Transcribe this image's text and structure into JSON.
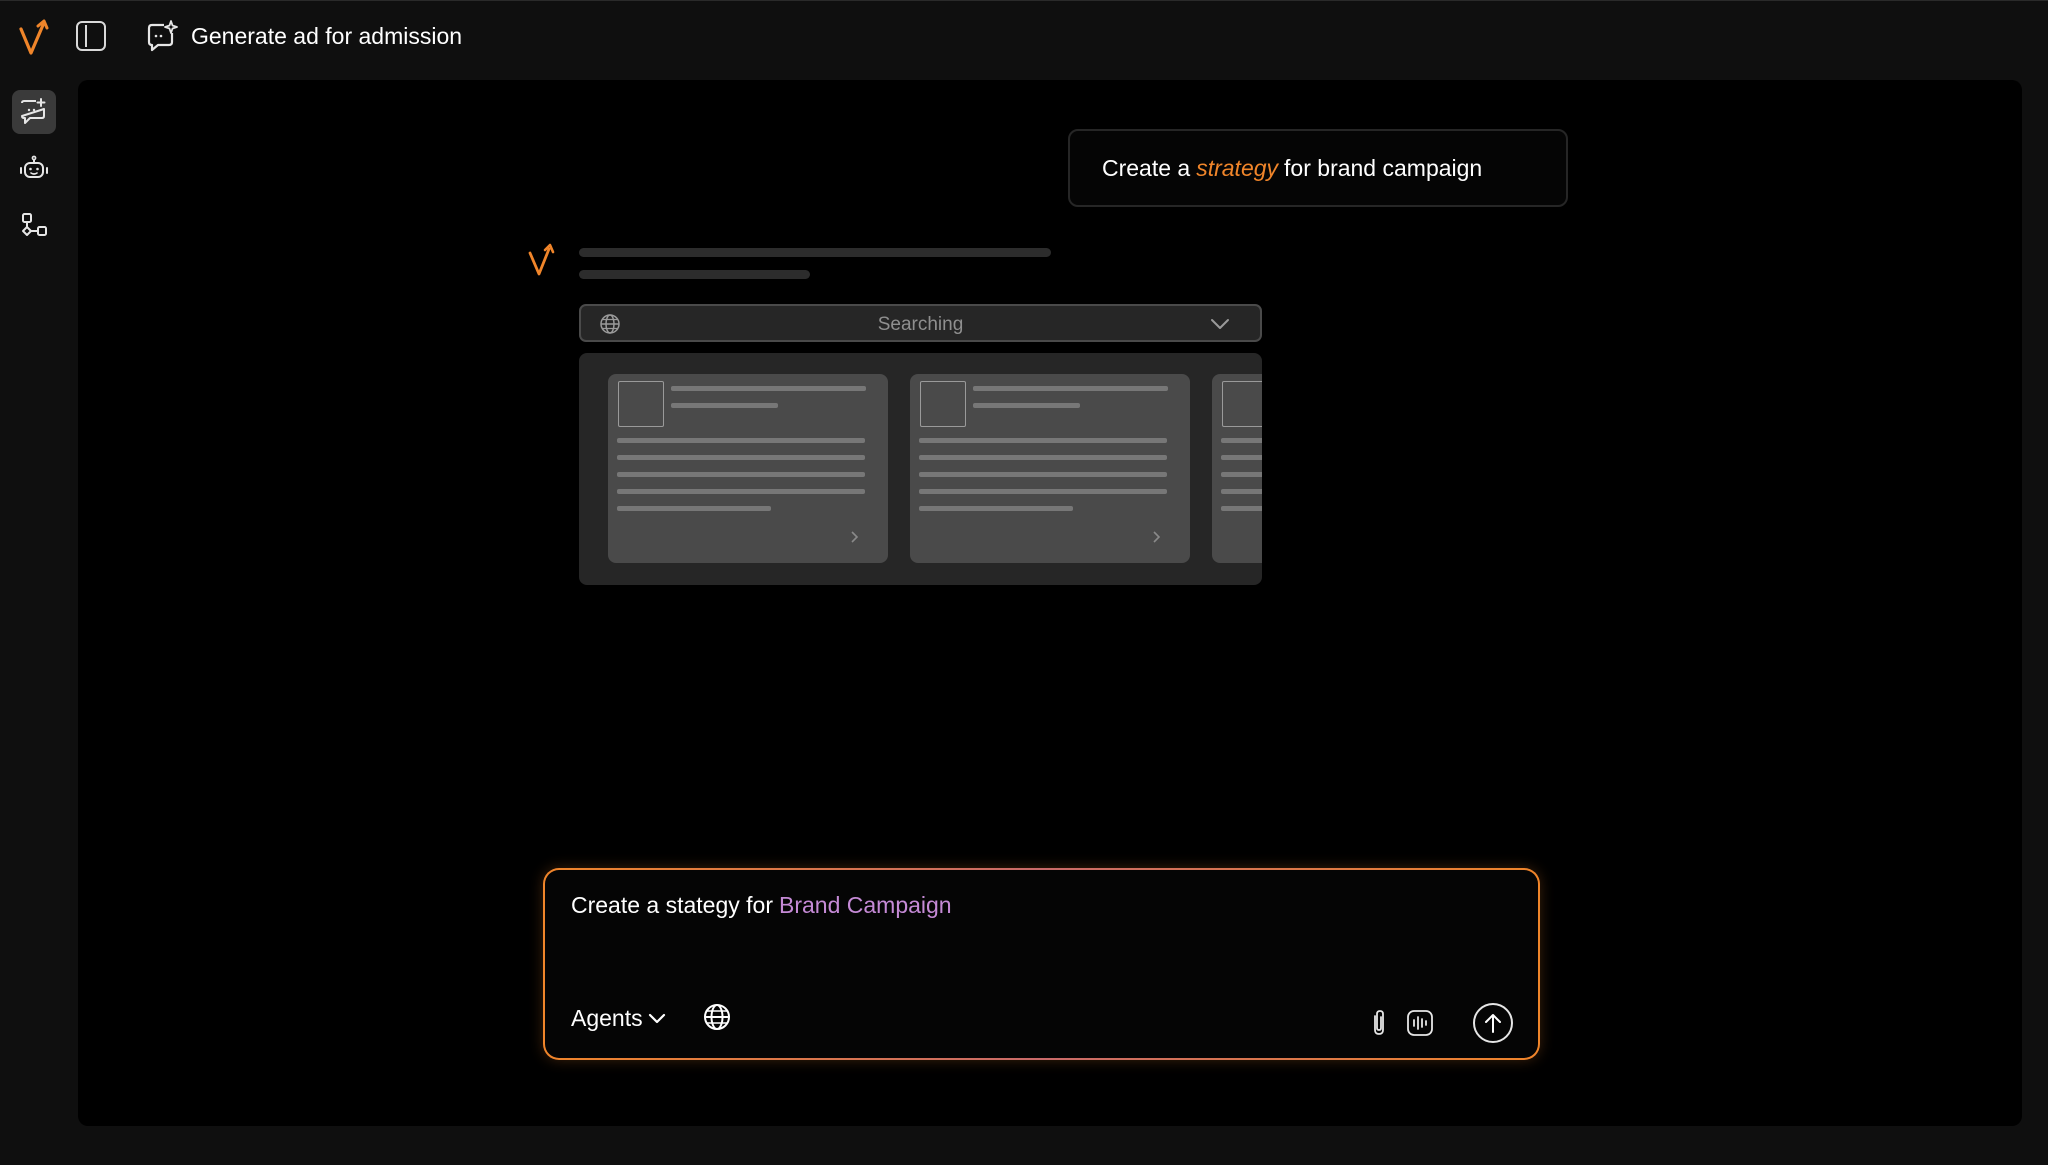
{
  "header": {
    "chat_title": "Generate ad for admission"
  },
  "rail": {
    "items": [
      {
        "icon": "new-chat-icon",
        "active": true
      },
      {
        "icon": "robot-icon",
        "active": false
      },
      {
        "icon": "workflow-icon",
        "active": false
      }
    ]
  },
  "conversation": {
    "user_message": {
      "prefix": "Create a",
      "highlight": "strategy",
      "suffix": "for brand campaign"
    },
    "assistant": {
      "search_status": "Searching"
    }
  },
  "composer": {
    "text": "Create a stategy for",
    "chip": "Brand Campaign",
    "agents_label": "Agents"
  },
  "colors": {
    "accent_orange": "#f0852a",
    "chip_purple": "#c58ad6",
    "background": "#000000",
    "chrome": "#0f0f0f"
  }
}
